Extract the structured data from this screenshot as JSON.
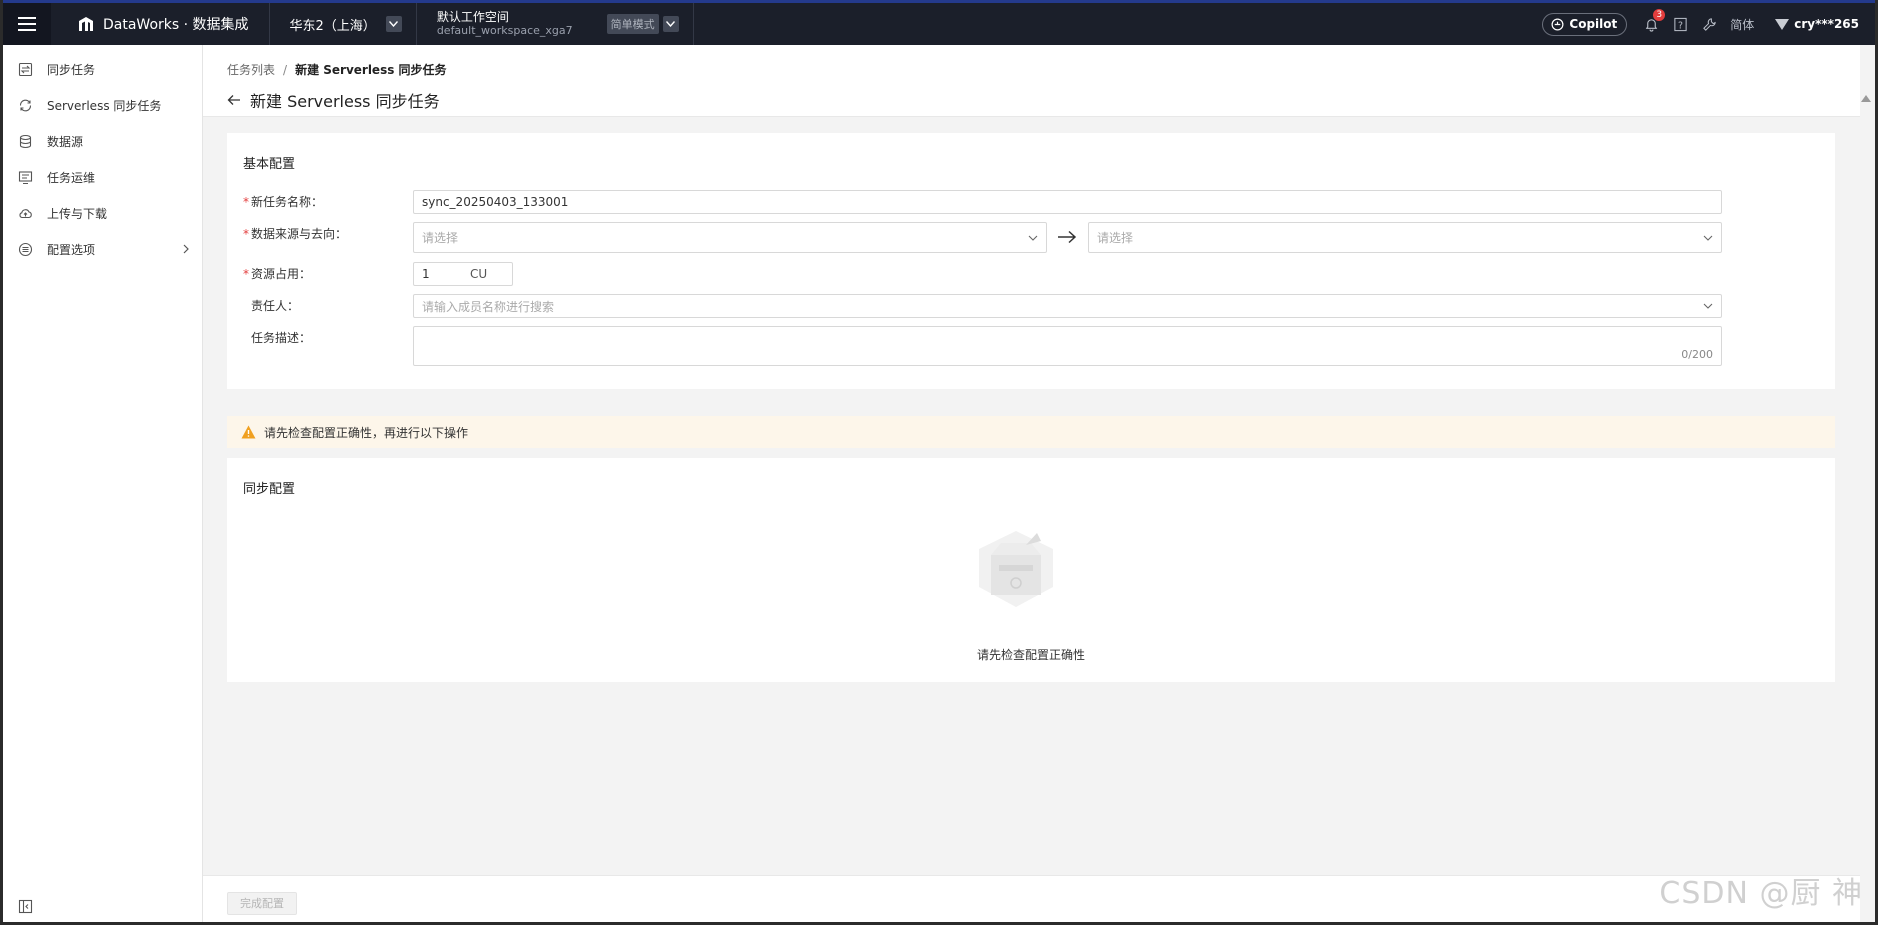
{
  "topbar": {
    "brand": "DataWorks · 数据集成",
    "region": "华东2（上海）",
    "workspace_name": "默认工作空间",
    "workspace_id": "default_workspace_xga7",
    "mode": "简单模式",
    "copilot": "Copilot",
    "notification_count": "3",
    "language": "简体",
    "user": "cry***265",
    "accent_color": "#243a8c"
  },
  "sidebar": {
    "items": [
      {
        "label": "同步任务",
        "icon": "sync-task-icon"
      },
      {
        "label": "Serverless 同步任务",
        "icon": "serverless-sync-icon"
      },
      {
        "label": "数据源",
        "icon": "database-icon"
      },
      {
        "label": "任务运维",
        "icon": "ops-icon"
      },
      {
        "label": "上传与下载",
        "icon": "cloud-upload-icon"
      },
      {
        "label": "配置选项",
        "icon": "config-icon"
      }
    ]
  },
  "header": {
    "breadcrumb_root": "任务列表",
    "breadcrumb_separator": "/",
    "breadcrumb_current": "新建 Serverless 同步任务",
    "title": "新建 Serverless 同步任务"
  },
  "basic": {
    "title": "基本配置",
    "task_name_label": "新任务名称：",
    "task_name_value": "sync_20250403_133001",
    "source_label": "数据来源与去向：",
    "source_placeholder": "请选择",
    "target_placeholder": "请选择",
    "resource_label": "资源占用：",
    "resource_value": "1",
    "resource_unit": "CU",
    "owner_label": "责任人：",
    "owner_placeholder": "请输入成员名称进行搜索",
    "desc_label": "任务描述：",
    "desc_counter": "0/200",
    "required_mark": "*"
  },
  "warning": {
    "text": "请先检查配置正确性，再进行以下操作",
    "color": "#f0a020"
  },
  "sync": {
    "title": "同步配置",
    "empty_text": "请先检查配置正确性"
  },
  "footer": {
    "finish_label": "完成配置"
  },
  "watermark": "CSDN @厨 神"
}
